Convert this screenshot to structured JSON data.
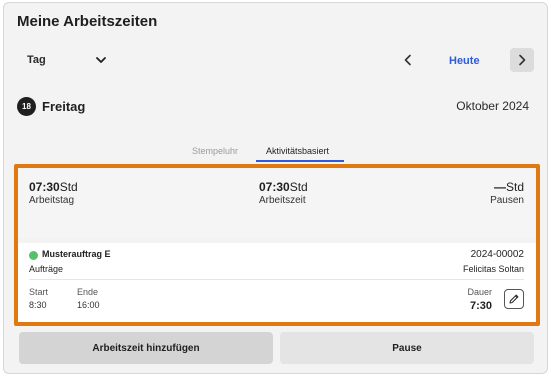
{
  "header": {
    "title": "Meine Arbeitszeiten"
  },
  "view_select": {
    "value": "Tag"
  },
  "nav": {
    "today_label": "Heute"
  },
  "date": {
    "day_number": "18",
    "day_name": "Freitag",
    "month_year": "Oktober 2024"
  },
  "tabs": [
    {
      "label": "Stempeluhr",
      "active": false
    },
    {
      "label": "Aktivitätsbasiert",
      "active": true
    }
  ],
  "summary": [
    {
      "value": "07:30",
      "unit": "Std",
      "label": "Arbeitstag"
    },
    {
      "value": "07:30",
      "unit": "Std",
      "label": "Arbeitszeit"
    },
    {
      "value": "—",
      "unit": "Std",
      "label": "Pausen"
    }
  ],
  "order": {
    "name": "Musterauftrag E",
    "id": "2024-00002",
    "type": "Aufträge",
    "person": "Felicitas Soltan",
    "start_label": "Start",
    "start": "8:30",
    "end_label": "Ende",
    "end": "16:00",
    "duration_label": "Dauer",
    "duration": "7:30",
    "status_color": "#5bbf6a"
  },
  "actions": {
    "add_label": "Arbeitszeit hinzufügen",
    "pause_label": "Pause"
  },
  "colors": {
    "accent": "#2f5bd8",
    "highlight": "#e07a10"
  }
}
